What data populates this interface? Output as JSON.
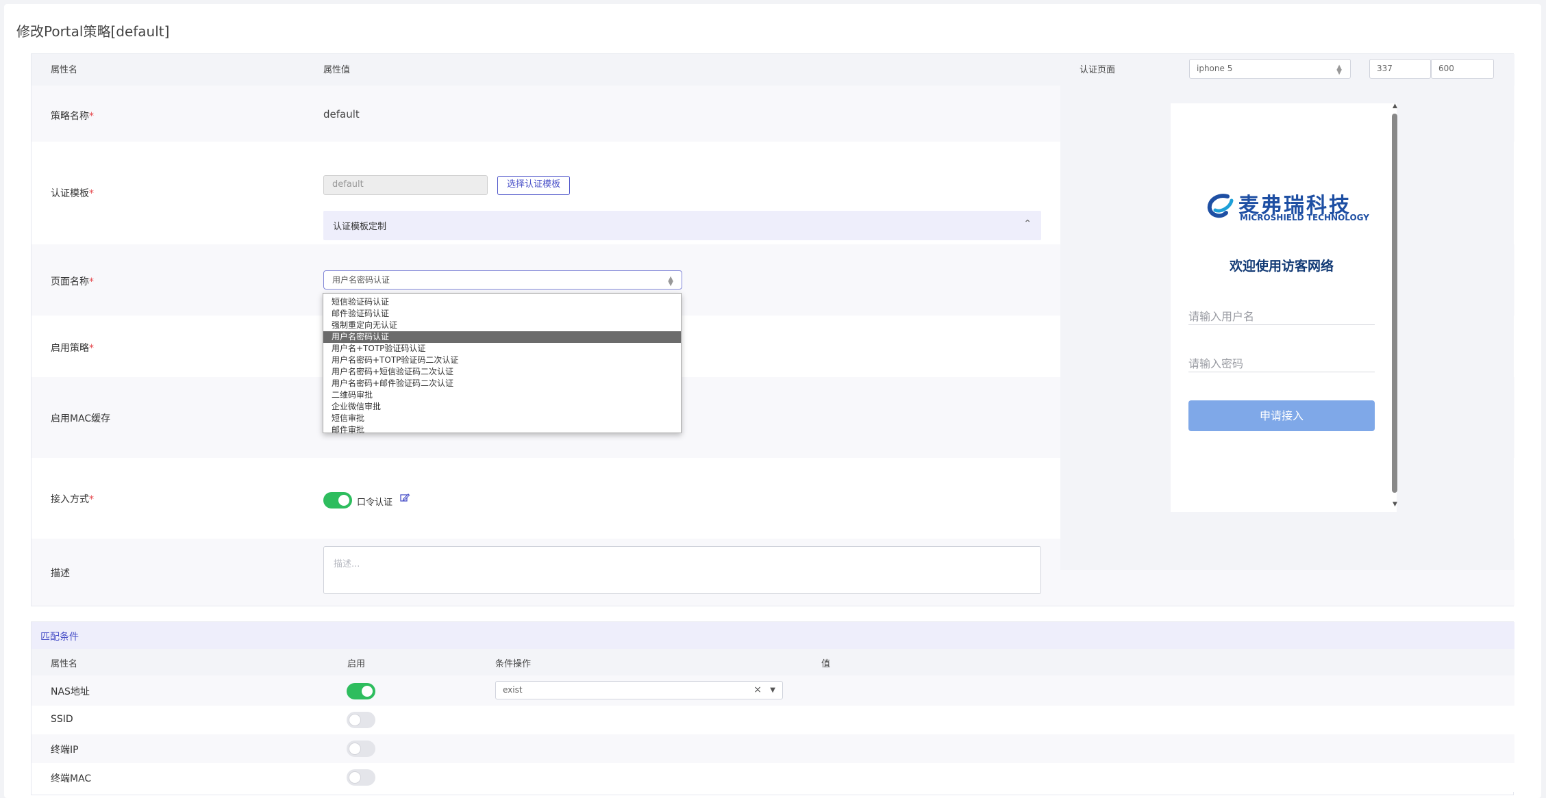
{
  "page": {
    "title": "修改Portal策略[default]"
  },
  "form": {
    "header": {
      "name": "属性名",
      "value": "属性值"
    },
    "policy_name": {
      "label": "策略名称",
      "required": "*",
      "value": "default"
    },
    "template": {
      "label": "认证模板",
      "required": "*",
      "value": "default",
      "choose_button": "选择认证模板",
      "customize": "认证模板定制"
    },
    "page_name": {
      "label": "页面名称",
      "required": "*",
      "selected": "用户名密码认证",
      "options": [
        "短信验证码认证",
        "邮件验证码认证",
        "强制重定向无认证",
        "用户名密码认证",
        "用户名+TOTP验证码认证",
        "用户名密码+TOTP验证码二次认证",
        "用户名密码+短信验证码二次认证",
        "用户名密码+邮件验证码二次认证",
        "二维码审批",
        "企业微信审批",
        "短信审批",
        "邮件审批"
      ],
      "selected_index": 3
    },
    "enable_policy": {
      "label": "启用策略",
      "required": "*"
    },
    "mac_cache": {
      "label": "启用MAC缓存"
    },
    "access_method": {
      "label": "接入方式",
      "required": "*",
      "option": "口令认证",
      "enabled": true
    },
    "description": {
      "label": "描述",
      "placeholder": "描述..."
    }
  },
  "preview": {
    "label": "认证页面",
    "device": "iphone 5",
    "width": "337",
    "height": "600",
    "logo_cn": "麦弗瑞科技",
    "logo_en": "MICROSHIELD TECHNOLOGY",
    "welcome": "欢迎使用访客网络",
    "username_placeholder": "请输入用户名",
    "password_placeholder": "请输入密码",
    "apply_button": "申请接入"
  },
  "match": {
    "title": "匹配条件",
    "headers": {
      "name": "属性名",
      "enable": "启用",
      "op": "条件操作",
      "value": "值"
    },
    "rows": [
      {
        "name": "NAS地址",
        "enabled": true,
        "op": "exist"
      },
      {
        "name": "SSID",
        "enabled": false
      },
      {
        "name": "终端IP",
        "enabled": false
      },
      {
        "name": "终端MAC",
        "enabled": false
      }
    ]
  },
  "colors": {
    "accent": "#4a51c8",
    "toggle_on": "#2ebd5e",
    "apply_button": "#7fa8e8",
    "header_bg": "#f3f4f8",
    "customize_bg": "#eeeefb"
  }
}
